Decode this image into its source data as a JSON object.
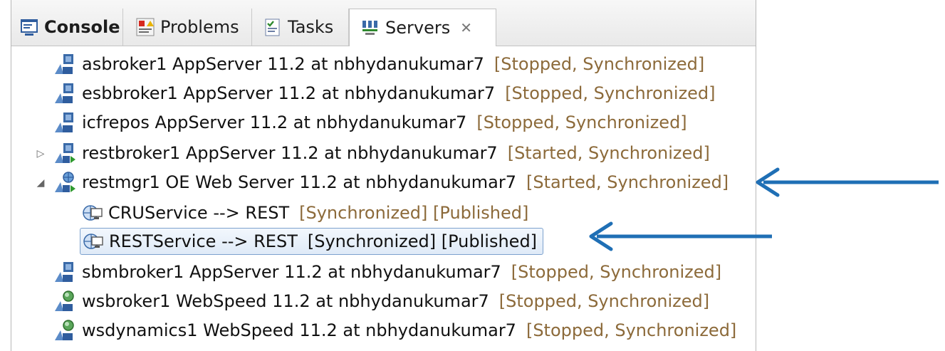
{
  "tabs": [
    {
      "label": "Console",
      "icon": "console-icon",
      "bold": true
    },
    {
      "label": "Problems",
      "icon": "problems-icon",
      "bold": false
    },
    {
      "label": "Tasks",
      "icon": "tasks-icon",
      "bold": false
    },
    {
      "label": "Servers",
      "icon": "servers-icon",
      "bold": false,
      "active": true,
      "close": "✕"
    }
  ],
  "servers": [
    {
      "name": "asbroker1 AppServer 11.2 at nbhydanukumar7",
      "status": "[Stopped, Synchronized]",
      "icon": "appserver-icon"
    },
    {
      "name": "esbbroker1 AppServer 11.2 at nbhydanukumar7",
      "status": "[Stopped, Synchronized]",
      "icon": "appserver-icon"
    },
    {
      "name": "icfrepos AppServer 11.2 at nbhydanukumar7",
      "status": "[Stopped, Synchronized]",
      "icon": "appserver-icon"
    },
    {
      "name": "restbroker1 AppServer 11.2 at nbhydanukumar7",
      "status": "[Started, Synchronized]",
      "icon": "appserver-started-icon",
      "expander": "collapsed"
    },
    {
      "name": "restmgr1 OE Web Server 11.2 at nbhydanukumar7",
      "status": "[Started, Synchronized]",
      "icon": "webserver-started-icon",
      "expander": "expanded"
    },
    {
      "name": "CRUService --> REST",
      "status": "[Synchronized] [Published]",
      "icon": "service-icon",
      "child": true
    },
    {
      "name": "RESTService --> REST",
      "status": "[Synchronized] [Published]",
      "icon": "service-icon",
      "child": true,
      "selected": true
    },
    {
      "name": "sbmbroker1 AppServer 11.2 at nbhydanukumar7",
      "status": "[Stopped, Synchronized]",
      "icon": "appserver-icon"
    },
    {
      "name": "wsbroker1 WebSpeed 11.2 at nbhydanukumar7",
      "status": "[Stopped, Synchronized]",
      "icon": "webspeed-icon"
    },
    {
      "name": "wsdynamics1 WebSpeed 11.2 at nbhydanukumar7",
      "status": "[Stopped, Synchronized]",
      "icon": "webspeed-icon"
    }
  ],
  "colors": {
    "status": "#8c6a3a",
    "annotation_arrow": "#1f6fb5",
    "selection_border": "#7da2ce"
  }
}
